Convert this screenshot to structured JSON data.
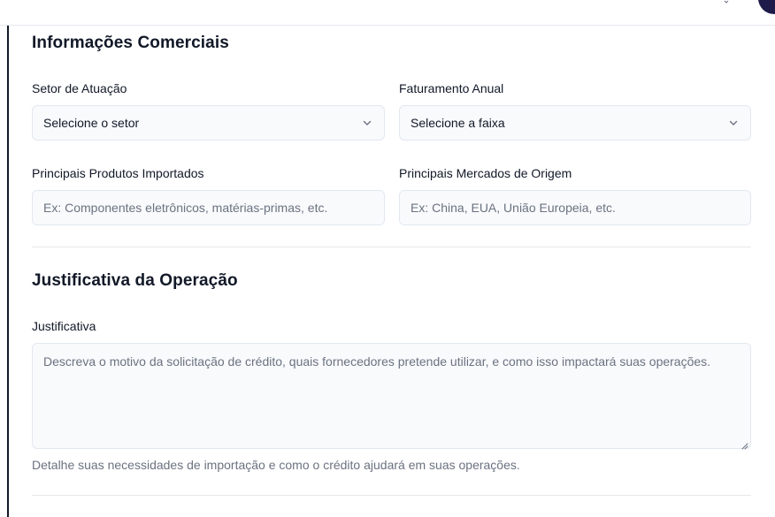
{
  "commercial": {
    "title": "Informações Comerciais",
    "sector": {
      "label": "Setor de Atuação",
      "value": "Selecione o setor"
    },
    "revenue": {
      "label": "Faturamento Anual",
      "value": "Selecione a faixa"
    },
    "products": {
      "label": "Principais Produtos Importados",
      "placeholder": "Ex: Componentes eletrônicos, matérias-primas, etc."
    },
    "markets": {
      "label": "Principais Mercados de Origem",
      "placeholder": "Ex: China, EUA, União Europeia, etc."
    }
  },
  "justification": {
    "title": "Justificativa da Operação",
    "field": {
      "label": "Justificativa",
      "placeholder": "Descreva o motivo da solicitação de crédito, quais fornecedores pretende utilizar, e como isso impactará suas operações.",
      "helper": "Detalhe suas necessidades de importação e como o crédito ajudará em suas operações."
    }
  },
  "icons": {
    "select_chevron": "chevron-down-icon",
    "avatar": "avatar"
  },
  "colors": {
    "field_background": "#f8fafc",
    "field_border": "#e2e8f0",
    "placeholder_text": "#6b7280",
    "heading_text": "#111827",
    "avatar": "#1e1b4b"
  }
}
